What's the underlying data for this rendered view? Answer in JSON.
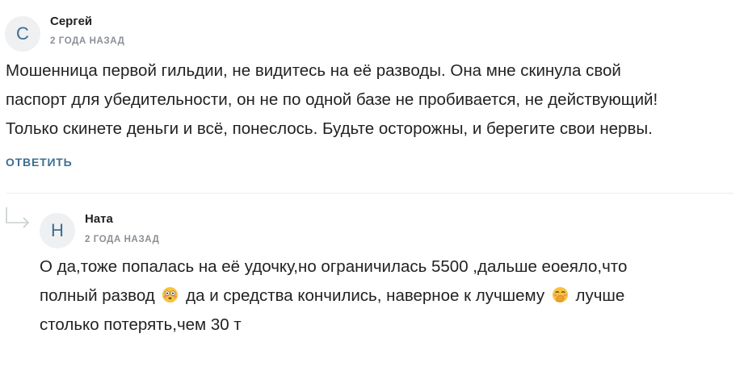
{
  "comments": [
    {
      "avatar_letter": "С",
      "author": "Сергей",
      "date": "2 года назад",
      "lines": [
        "Мошенница первой гильдии, не видитесь на её разводы. Она мне скинула свой",
        "паспорт для убедительности, он не по одной базе не пробивается, не действующий!",
        "Только скинете деньги и всё, понеслось. Будьте осторожны, и берегите свои нервы."
      ],
      "reply_label": "Ответить"
    }
  ],
  "replies": [
    {
      "avatar_letter": "Н",
      "author": "Ната",
      "date": "2 года назад",
      "line1": "О да,тоже попалась на её удочку,но ограничилась 5500 ,дальше еоеяло,что",
      "line2_part1": "полный развод",
      "line2_part2": "да и средства кончились, наверное к лучшему",
      "line2_part3": "лучше",
      "line3": "столько потерять,чем 30 т",
      "emoji_1": "flushed-face-emoji",
      "emoji_2": "face-with-hand-over-mouth-emoji"
    }
  ],
  "colors": {
    "accent": "#3f6f8f",
    "avatar_bg": "#eef0f2",
    "muted": "#8a8f95",
    "text": "#222222",
    "divider": "#ececec"
  }
}
